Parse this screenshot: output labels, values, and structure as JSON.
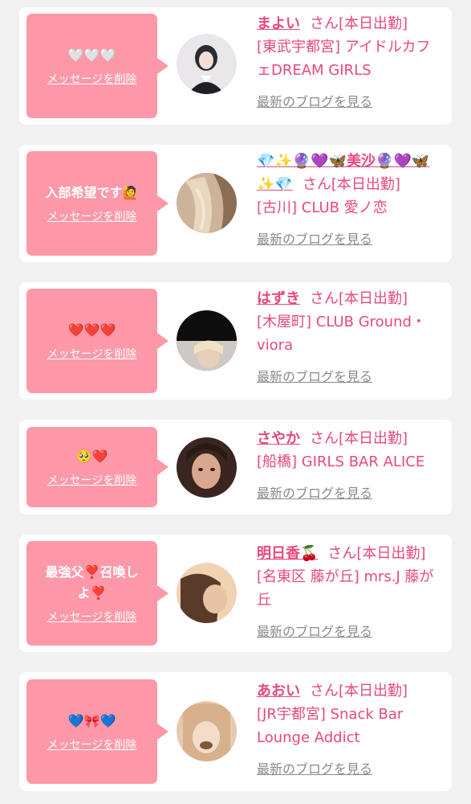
{
  "delete_label": "メッセージを削除",
  "blog_label": "最新のブログを見る",
  "cards": [
    {
      "message": "🤍🤍🤍",
      "name": "まよい",
      "san": "さん[本日出勤]",
      "shop": "[東武宇都宮] アイドルカフェDREAM GIRLS",
      "avatar_colors": [
        "#e9e7ea",
        "#2b2b33"
      ]
    },
    {
      "message": "入部希望です🙋",
      "name": "💎✨🔮💜🦋美沙🔮💜🦋✨💎",
      "san": "さん[本日出勤]",
      "shop": "[古川] CLUB 愛ノ恋",
      "avatar_colors": [
        "#d9bfa6",
        "#8a6d52"
      ]
    },
    {
      "message": "❤️❤️❤️",
      "name": "はずき",
      "san": "さん[本日出勤]",
      "shop": "[木屋町] CLUB Ground・viora",
      "avatar_colors": [
        "#0d0d0d",
        "#e6d0b8"
      ]
    },
    {
      "message": "🥺❤️",
      "name": "さやか",
      "san": "さん[本日出勤]",
      "shop": "[船橋] GIRLS BAR ALICE",
      "avatar_colors": [
        "#3a2520",
        "#d9a78f"
      ]
    },
    {
      "message": "最強父❣️召喚しよ❣️",
      "name": "明日香🍒",
      "san": "さん[本日出勤]",
      "shop": "[名東区 藤が丘] mrs.J 藤が丘",
      "avatar_colors": [
        "#f1d2b3",
        "#5a3a28"
      ]
    },
    {
      "message": "💙🎀💙",
      "name": "あおい",
      "san": "さん[本日出勤]",
      "shop": "[JR宇都宮] Snack Bar Lounge Addict",
      "avatar_colors": [
        "#e7c9b0",
        "#7a5a3a"
      ]
    }
  ]
}
